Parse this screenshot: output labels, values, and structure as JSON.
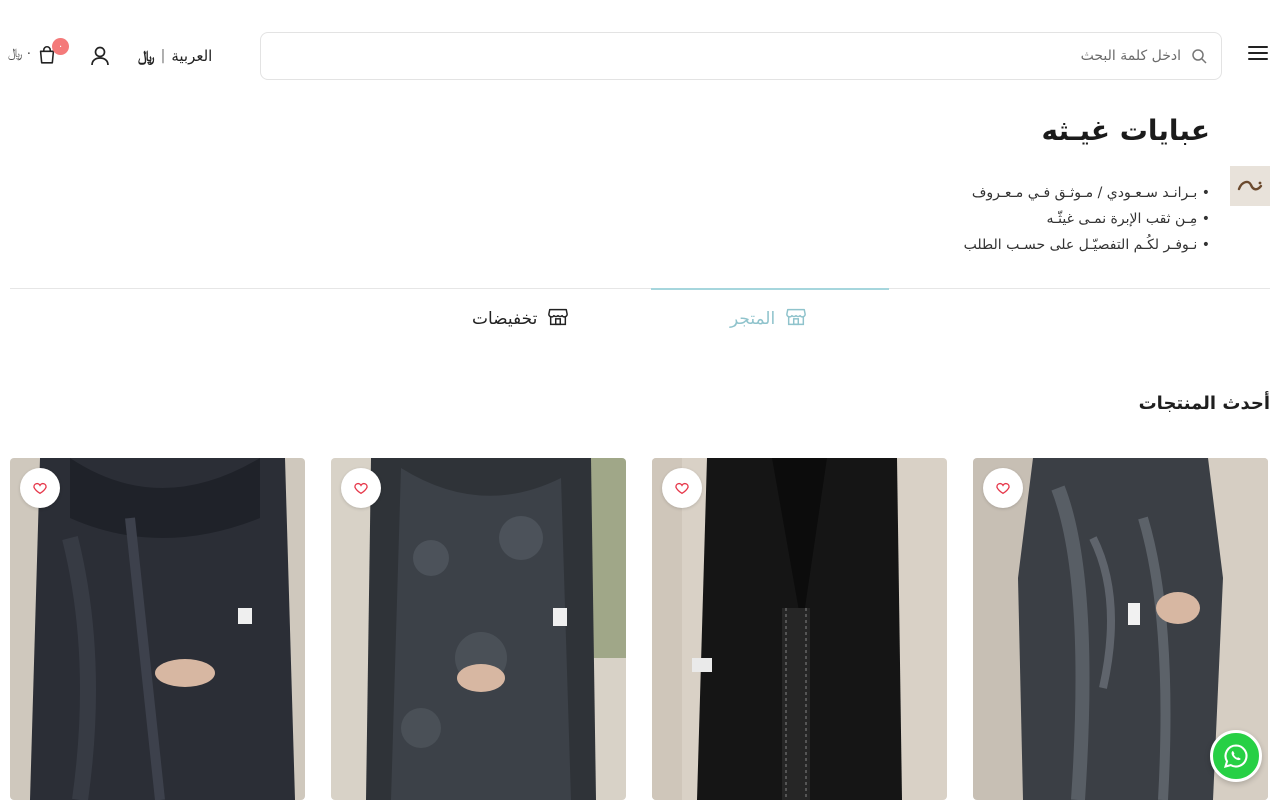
{
  "header": {
    "search": {
      "placeholder": "ادخل كلمة البحث",
      "value": ""
    },
    "language_label": "العربية",
    "language_separator": "|",
    "currency_symbol": "﷼",
    "cart": {
      "count": "٠",
      "total": "٠",
      "currency_symbol": "﷼"
    },
    "icons": {
      "menu": "hamburger-menu-icon",
      "search": "search-icon",
      "user": "user-icon",
      "cart": "shopping-bag-icon"
    }
  },
  "store": {
    "name": "عبايات غيـثه",
    "description": [
      "بـرانـد سـعـودي / مـوثـق فـي مـعـروف",
      "مِـن ثقب الإبرة نمـى غيثّـه",
      "نـوفـر لكُـم التفصيّـل على حسـب الطلب"
    ]
  },
  "tabs": [
    {
      "label": "المتجر",
      "icon": "storefront-icon",
      "active": true
    },
    {
      "label": "تخفيضات",
      "icon": "storefront-icon",
      "active": false
    }
  ],
  "section": {
    "title": "أحدث المنتجات"
  },
  "products": [
    {
      "image": "black-patterned-abaya-image",
      "favorite": false
    },
    {
      "image": "black-embroidered-abaya-image",
      "favorite": false
    },
    {
      "image": "grey-floral-abaya-image",
      "favorite": false
    },
    {
      "image": "navy-satin-abaya-image",
      "favorite": false
    }
  ],
  "colors": {
    "accent": "#a6d6dd",
    "active_tab_text": "#8fc3cc",
    "badge": "#f47a7a",
    "wishlist_heart": "#e6374a",
    "whatsapp": "#27d045"
  },
  "floating": {
    "whatsapp_icon": "whatsapp-icon"
  }
}
